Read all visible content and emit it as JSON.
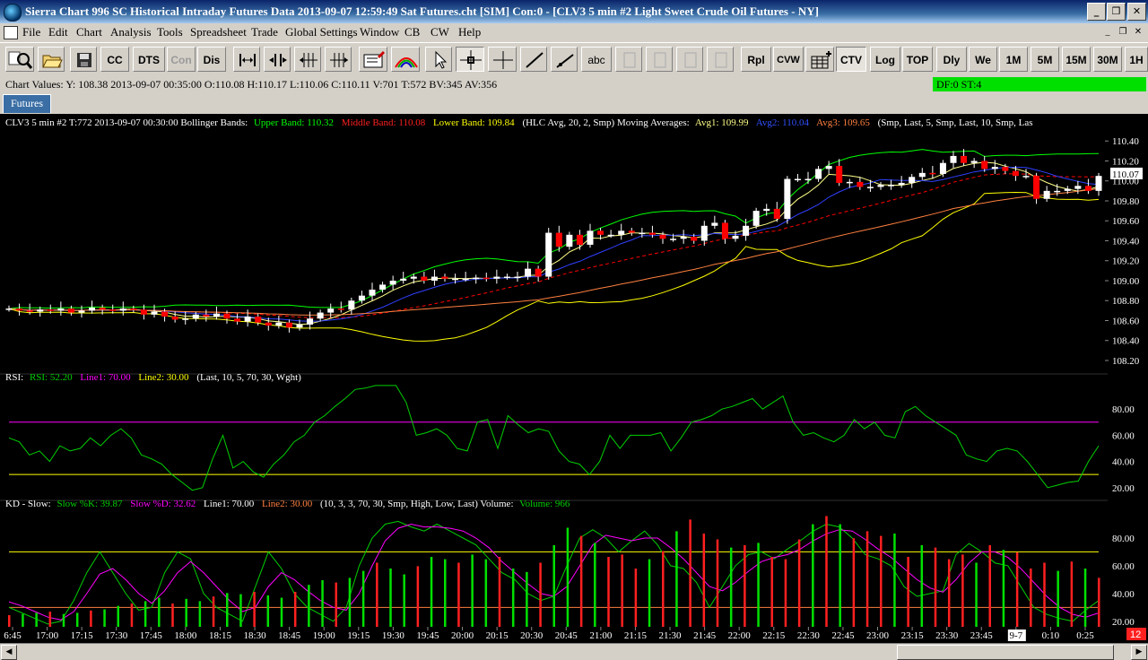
{
  "window": {
    "title": "Sierra Chart 996 SC Historical Intraday Futures Data 2013-09-07  12:59:49 Sat  Futures.cht [SIM] Con:0 - [CLV3  5 min  #2  Light Sweet Crude Oil Futures - NY]"
  },
  "menu": {
    "items": [
      "File",
      "Edit",
      "Chart",
      "Analysis",
      "Tools",
      "Spreadsheet",
      "Trade",
      "Global Settings",
      "Window",
      "CB",
      "CW",
      "Help"
    ]
  },
  "toolbar": {
    "cc": "CC",
    "dts": "DTS",
    "con": "Con",
    "dis": "Dis",
    "abc": "abc",
    "rpl": "Rpl",
    "cvw": "CVW",
    "ctv": "CTV",
    "log": "Log",
    "top": "TOP",
    "dly": "Dly",
    "we": "We",
    "m1": "1M",
    "m5": "5M",
    "m15": "15M",
    "m30": "30M",
    "h1": "1H"
  },
  "status": {
    "chart_values": "Chart Values: Y: 108.38  2013-09-07  00:35:00  O:110.08  H:110.17  L:110.06  C:110.11  V:701  T:572  BV:345  AV:356",
    "df": "DF:0  ST:4"
  },
  "tabs": [
    "Futures"
  ],
  "colors": {
    "up": "#ffffff",
    "down": "#ff0000",
    "upper_band": "#00ff00",
    "middle_band": "#ff0000",
    "lower_band": "#ffff00",
    "avg1": "#ffff88",
    "avg2": "#3040ff",
    "avg3": "#ff8040",
    "rsi": "#00d000",
    "line1": "#ff00ff",
    "line2": "#ffff00",
    "slowk": "#00d000",
    "slowd": "#ff00ff"
  },
  "chart_data": [
    {
      "type": "candlestick",
      "header": {
        "prefix": "CLV3  5 min  #2 T:772 2013-09-07 00:30:00  Bollinger Bands:",
        "upper": "Upper Band: 110.32",
        "middle": "Middle Band: 110.08",
        "lower": "Lower Band: 109.84",
        "params": "(HLC Avg, 20, 2, Smp)  Moving Averages:",
        "avg1": "Avg1: 109.99",
        "avg2": "Avg2: 110.04",
        "avg3": "Avg3: 109.65",
        "params2": "(Smp, Last, 5, Smp, Last, 10, Smp, Las"
      },
      "y_ticks": [
        "110.40",
        "110.20",
        "110.00",
        "109.80",
        "109.60",
        "109.40",
        "109.20",
        "109.00",
        "108.80",
        "108.60",
        "108.40",
        "108.20"
      ],
      "ylim": [
        108.11,
        110.51
      ],
      "last_price": "110.07",
      "close": [
        108.72,
        108.7,
        108.69,
        108.71,
        108.7,
        108.72,
        108.68,
        108.7,
        108.73,
        108.71,
        108.7,
        108.72,
        108.71,
        108.66,
        108.69,
        108.64,
        108.61,
        108.62,
        108.66,
        108.64,
        108.67,
        108.62,
        108.59,
        108.64,
        108.58,
        108.55,
        108.58,
        108.53,
        108.56,
        108.62,
        108.68,
        108.72,
        108.71,
        108.8,
        108.85,
        108.91,
        108.96,
        109.0,
        109.02,
        109.04,
        109.0,
        109.04,
        109.02,
        109.02,
        109.02,
        109.03,
        109.02,
        109.04,
        109.04,
        109.04,
        109.12,
        109.04,
        109.48,
        109.34,
        109.46,
        109.36,
        109.5,
        109.46,
        109.46,
        109.5,
        109.48,
        109.48,
        109.46,
        109.42,
        109.42,
        109.44,
        109.4,
        109.55,
        109.58,
        109.42,
        109.45,
        109.55,
        109.7,
        109.72,
        109.62,
        110.02,
        110.02,
        110.02,
        110.12,
        110.15,
        109.98,
        109.99,
        109.94,
        109.94,
        109.96,
        109.96,
        109.98,
        110.04,
        110.08,
        110.07,
        110.18,
        110.25,
        110.18,
        110.2,
        110.12,
        110.14,
        110.1,
        110.05,
        110.05,
        109.82,
        109.9,
        109.9,
        109.92,
        109.95,
        109.9,
        110.05
      ],
      "x_ticks": [
        "6:45",
        "17:00",
        "17:15",
        "17:30",
        "17:45",
        "18:00",
        "18:15",
        "18:30",
        "18:45",
        "19:00",
        "19:15",
        "19:30",
        "19:45",
        "20:00",
        "20:15",
        "20:30",
        "20:45",
        "21:00",
        "21:15",
        "21:30",
        "21:45",
        "22:00",
        "22:15",
        "22:30",
        "22:45",
        "23:00",
        "23:15",
        "23:30",
        "23:45",
        "9-7",
        "0:10",
        "0:25"
      ]
    },
    {
      "type": "line",
      "title": "RSI",
      "header": {
        "prefix": "RSI:",
        "rsi": "RSI: 52.20",
        "line1": "Line1: 70.00",
        "line2": "Line2: 30.00",
        "params": "(Last, 10, 5, 70, 30, Wght)"
      },
      "y_ticks": [
        "80.00",
        "60.00",
        "40.00",
        "20.00"
      ],
      "ylim": [
        13,
        100
      ],
      "line1": 70,
      "line2": 30,
      "values": [
        58,
        55,
        45,
        48,
        40,
        52,
        48,
        50,
        58,
        52,
        60,
        65,
        58,
        45,
        42,
        38,
        30,
        24,
        18,
        20,
        42,
        60,
        35,
        40,
        32,
        28,
        38,
        45,
        55,
        60,
        70,
        75,
        82,
        88,
        95,
        96,
        98,
        98,
        98,
        85,
        60,
        62,
        65,
        60,
        50,
        48,
        70,
        72,
        50,
        75,
        68,
        62,
        65,
        63,
        48,
        40,
        38,
        30,
        40,
        60,
        50,
        60,
        60,
        60,
        62,
        48,
        58,
        70,
        72,
        75,
        80,
        82,
        85,
        88,
        80,
        85,
        90,
        70,
        60,
        62,
        58,
        55,
        60,
        72,
        65,
        70,
        60,
        58,
        78,
        82,
        75,
        70,
        65,
        60,
        45,
        42,
        40,
        48,
        50,
        48,
        40,
        30,
        20,
        22,
        24,
        25,
        40,
        52
      ]
    },
    {
      "type": "line+bar",
      "title": "KD - Slow",
      "header": {
        "prefix": "KD - Slow:",
        "k": "Slow %K: 39.87",
        "d": "Slow %D: 32.62",
        "line1": "Line1: 70.00",
        "line2": "Line2: 30.00",
        "params": "(10, 3, 3, 70, 30, Smp, High, Low, Last)  Volume:",
        "volume": "Volume: 966"
      },
      "y_ticks": [
        "80.00",
        "60.00",
        "40.00",
        "20.00"
      ],
      "ylim": [
        16,
        100
      ],
      "line1": 70,
      "line2": 30,
      "slow_k": [
        30,
        26,
        22,
        18,
        20,
        35,
        55,
        70,
        55,
        40,
        28,
        30,
        55,
        70,
        65,
        40,
        30,
        25,
        20,
        45,
        70,
        58,
        40,
        30,
        25,
        20,
        30,
        60,
        80,
        90,
        92,
        88,
        85,
        90,
        85,
        80,
        75,
        65,
        55,
        50,
        40,
        35,
        38,
        60,
        80,
        86,
        80,
        70,
        78,
        85,
        75,
        60,
        58,
        48,
        30,
        45,
        60,
        68,
        70,
        65,
        72,
        78,
        85,
        90,
        88,
        80,
        68,
        65,
        60,
        45,
        38,
        40,
        42,
        68,
        76,
        70,
        62,
        60,
        45,
        30,
        25,
        22,
        20,
        28,
        35
      ],
      "slow_d": [
        34,
        31,
        27,
        23,
        21,
        27,
        40,
        54,
        58,
        50,
        40,
        33,
        42,
        55,
        63,
        55,
        45,
        35,
        27,
        30,
        45,
        55,
        50,
        42,
        35,
        30,
        28,
        40,
        60,
        78,
        87,
        90,
        88,
        88,
        87,
        85,
        80,
        73,
        63,
        55,
        47,
        40,
        38,
        45,
        60,
        75,
        82,
        80,
        78,
        80,
        80,
        73,
        65,
        55,
        45,
        42,
        48,
        56,
        63,
        66,
        68,
        72,
        78,
        83,
        86,
        85,
        79,
        72,
        66,
        58,
        50,
        44,
        41,
        50,
        62,
        70,
        70,
        66,
        58,
        48,
        38,
        30,
        25,
        23,
        26
      ],
      "volume": [
        10,
        11,
        12,
        13,
        11,
        12,
        14,
        15,
        18,
        20,
        22,
        25,
        20,
        24,
        22,
        26,
        29,
        28,
        30,
        27,
        25,
        30,
        36,
        40,
        38,
        42,
        48,
        55,
        50,
        45,
        52,
        60,
        58,
        55,
        62,
        58,
        60,
        50,
        47,
        55,
        70,
        85,
        78,
        72,
        60,
        62,
        50,
        58,
        65,
        82,
        92,
        80,
        75,
        68,
        70,
        72,
        60,
        58,
        75,
        88,
        95,
        88,
        76,
        82,
        78,
        80,
        60,
        70,
        68,
        58,
        62,
        55,
        70,
        66,
        64,
        50,
        55,
        48,
        56,
        50,
        42
      ]
    }
  ]
}
